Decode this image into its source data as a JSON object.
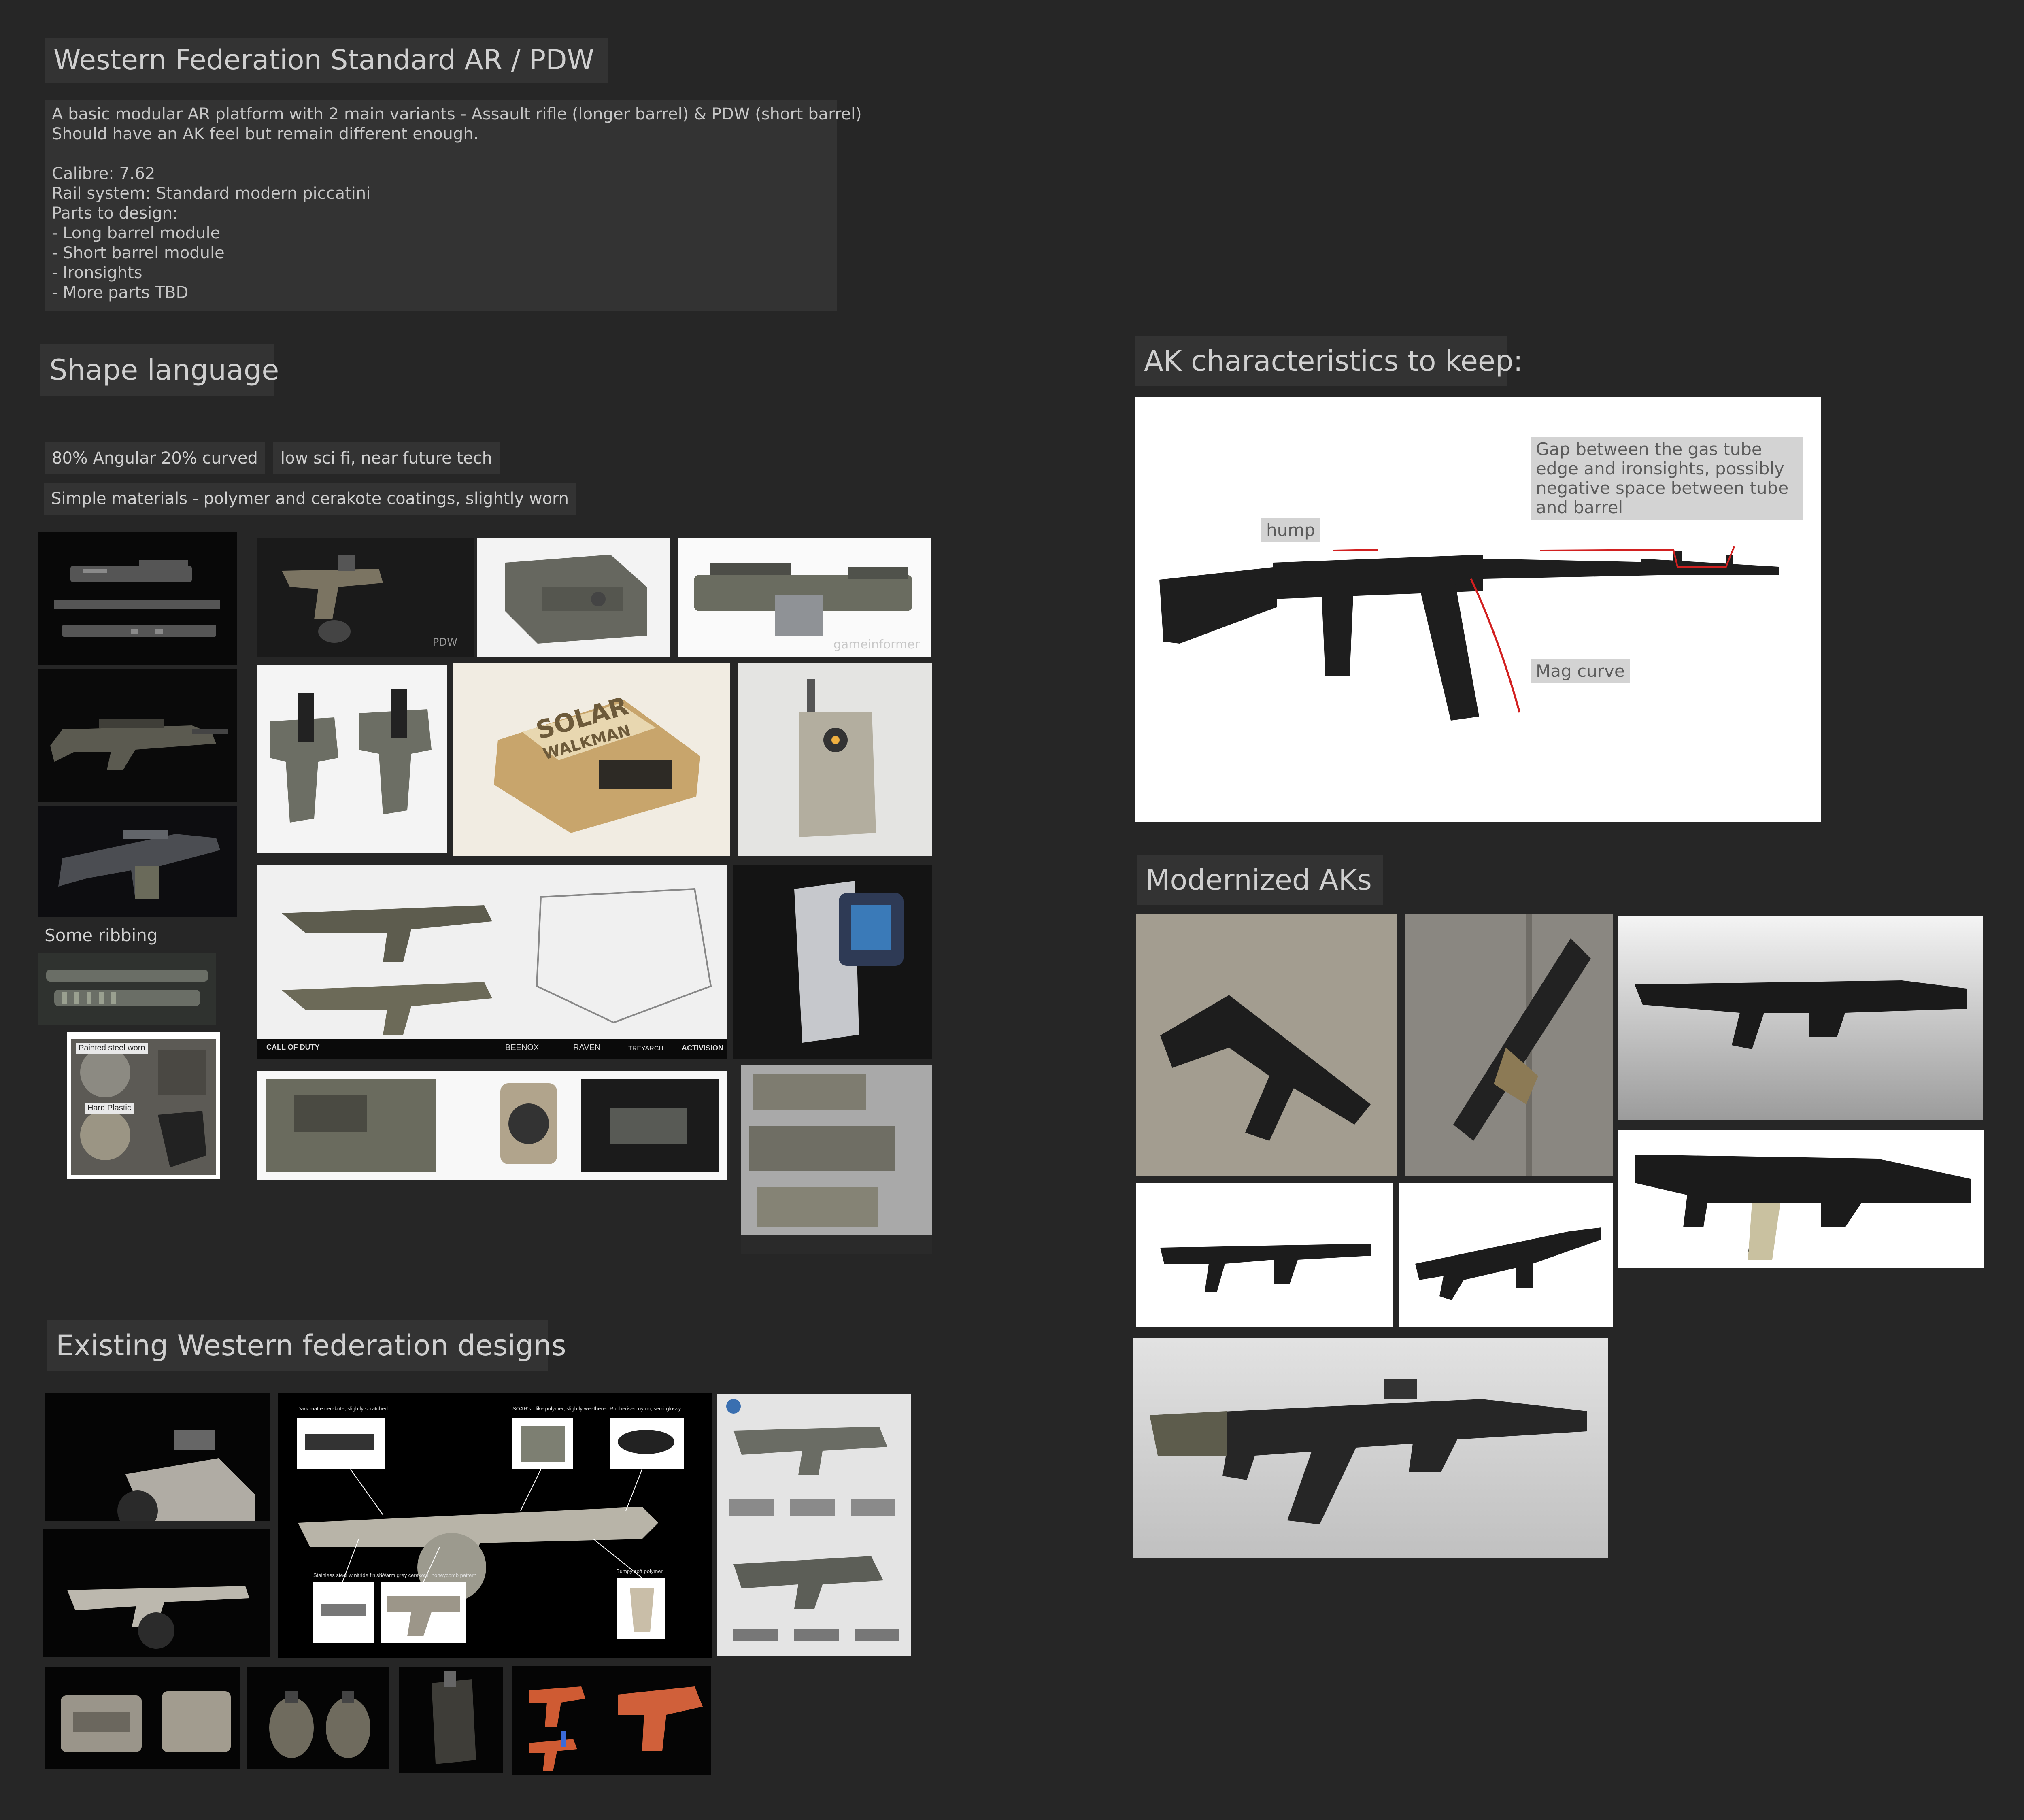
{
  "title": "Western Federation Standard AR / PDW",
  "brief_lines": [
    "A basic modular AR platform with 2 main variants - Assault rifle (longer barrel) & PDW (short barrel)",
    "Should have an AK feel but remain different enough.",
    "",
    "Calibre: 7.62",
    "Rail system: Standard modern piccatini",
    "Parts to design:",
    "- Long barrel module",
    "- Short barrel module",
    "- Ironsights",
    "- More parts TBD"
  ],
  "shape_language": {
    "heading": "Shape language",
    "tags": [
      "80% Angular 20% curved",
      "low sci fi, near future tech",
      "Simple materials - polymer and cerakote coatings, slightly worn"
    ],
    "ribbing_caption": "Some ribbing",
    "material_labels": [
      "Painted steel worn",
      "Hard Plastic"
    ],
    "watermarks": [
      "PDW",
      "gameinformer"
    ],
    "device_text": [
      "SOLAR",
      "WALKMAN"
    ],
    "logos": [
      "CALL OF DUTY",
      "BEENOX",
      "RAVEN",
      "TREYARCH",
      "ACTIVISION"
    ]
  },
  "ak_characteristics": {
    "heading": "AK characteristics to keep:",
    "notes": [
      "hump",
      "Gap between the gas tube edge and ironsights, possibly negative space between tube and barrel",
      "Mag curve"
    ]
  },
  "modernized": {
    "heading": "Modernized AKs"
  },
  "existing": {
    "heading": "Existing Western federation designs",
    "callouts": [
      "Dark matte cerakote, slightly scratched",
      "SOAR's - like polymer, slightly weathered",
      "Rubberised nylon, semi glossy",
      "Stainless steel w nitride finish",
      "Warm grey cerakote, honeycomb pattern",
      "Bumpy soft polymer"
    ]
  },
  "colors": {
    "background": "#262626",
    "label_bg": "#333333",
    "text": "#cfcfcf",
    "annotation_red": "#d22020"
  }
}
